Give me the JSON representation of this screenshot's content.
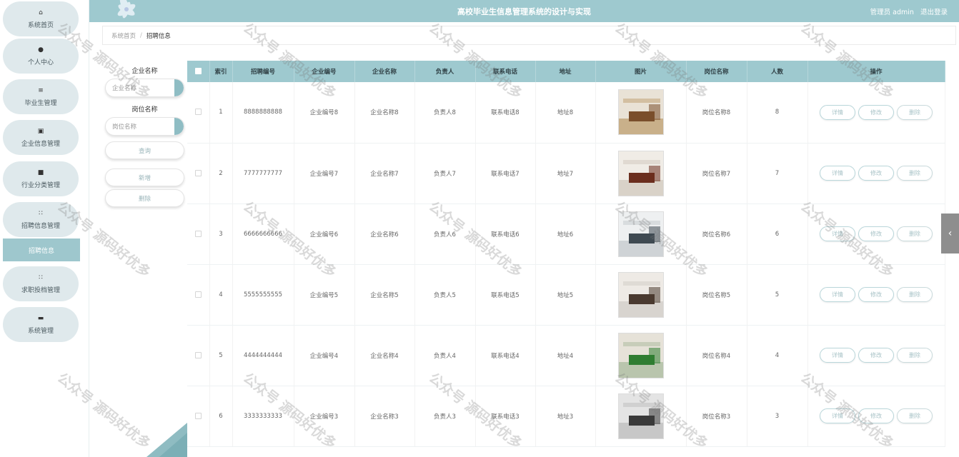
{
  "header": {
    "title": "高校毕业生信息管理系统的设计与实现",
    "user_label": "管理员 admin",
    "logout_label": "退出登录"
  },
  "sidebar": {
    "items": [
      {
        "label": "系统首页",
        "icon": "home-icon"
      },
      {
        "label": "个人中心",
        "icon": "user-icon"
      },
      {
        "label": "毕业生管理",
        "icon": "list-icon"
      },
      {
        "label": "企业信息管理",
        "icon": "edit-icon"
      },
      {
        "label": "行业分类管理",
        "icon": "video-icon"
      },
      {
        "label": "招聘信息管理",
        "icon": "grid-icon"
      },
      {
        "label": "求职投档管理",
        "icon": "grid-icon"
      },
      {
        "label": "系统管理",
        "icon": "chat-icon"
      }
    ],
    "active_sub": "招聘信息"
  },
  "breadcrumb": {
    "home": "系统首页",
    "separator": "/",
    "current": "招聘信息"
  },
  "search": {
    "company_label": "企业名称",
    "company_placeholder": "企业名称",
    "job_label": "岗位名称",
    "job_placeholder": "岗位名称",
    "query_label": "查询",
    "add_label": "新增",
    "delete_label": "删除"
  },
  "table": {
    "columns": [
      "索引",
      "招聘编号",
      "企业编号",
      "企业名称",
      "负责人",
      "联系电话",
      "地址",
      "图片",
      "岗位名称",
      "人数",
      "操作"
    ],
    "actions": {
      "detail": "详情",
      "edit": "修改",
      "delete": "删除"
    },
    "rows": [
      {
        "index": "1",
        "recruit_no": "8888888888",
        "company_no": "企业编号8",
        "company_name": "企业名称8",
        "manager": "负责人8",
        "phone": "联系电话8",
        "address": "地址8",
        "job": "岗位名称8",
        "count": "8"
      },
      {
        "index": "2",
        "recruit_no": "7777777777",
        "company_no": "企业编号7",
        "company_name": "企业名称7",
        "manager": "负责人7",
        "phone": "联系电话7",
        "address": "地址7",
        "job": "岗位名称7",
        "count": "7"
      },
      {
        "index": "3",
        "recruit_no": "6666666666",
        "company_no": "企业编号6",
        "company_name": "企业名称6",
        "manager": "负责人6",
        "phone": "联系电话6",
        "address": "地址6",
        "job": "岗位名称6",
        "count": "6"
      },
      {
        "index": "4",
        "recruit_no": "5555555555",
        "company_no": "企业编号5",
        "company_name": "企业名称5",
        "manager": "负责人5",
        "phone": "联系电话5",
        "address": "地址5",
        "job": "岗位名称5",
        "count": "5"
      },
      {
        "index": "5",
        "recruit_no": "4444444444",
        "company_no": "企业编号4",
        "company_name": "企业名称4",
        "manager": "负责人4",
        "phone": "联系电话4",
        "address": "地址4",
        "job": "岗位名称4",
        "count": "4"
      },
      {
        "index": "6",
        "recruit_no": "3333333333",
        "company_no": "企业编号3",
        "company_name": "企业名称3",
        "manager": "负责人3",
        "phone": "联系电话3",
        "address": "地址3",
        "job": "岗位名称3",
        "count": "3"
      }
    ]
  },
  "watermark": "公众号 源码好优多",
  "colors": {
    "accent": "#9ec9cf",
    "nav_bg": "#dfe9ec",
    "active_sub": "#9ec7cd",
    "side_tab": "#8e8e8e"
  }
}
